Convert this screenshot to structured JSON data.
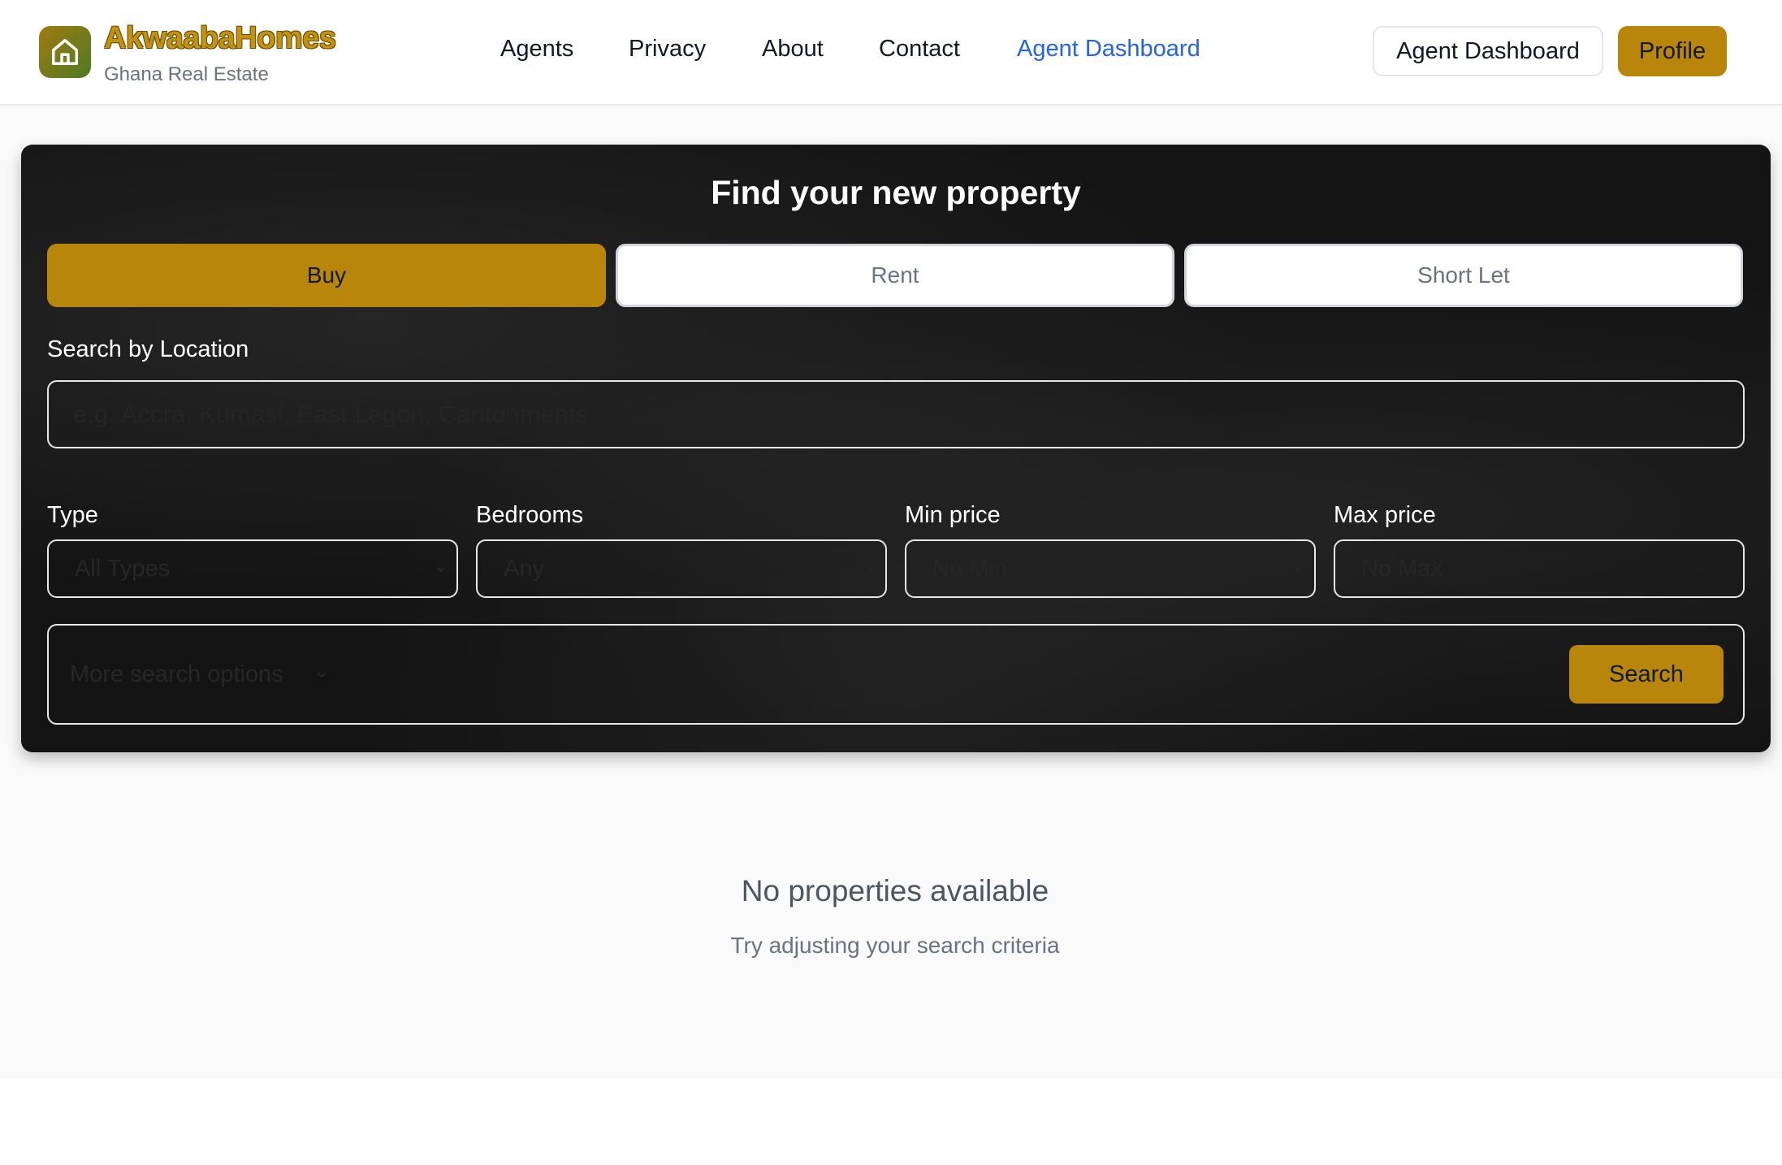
{
  "brand": {
    "name": "AkwaabaHomes",
    "tagline": "Ghana Real Estate"
  },
  "nav": {
    "items": [
      {
        "label": "Agents"
      },
      {
        "label": "Privacy"
      },
      {
        "label": "About"
      },
      {
        "label": "Contact"
      },
      {
        "label": "Agent Dashboard",
        "active": true
      }
    ]
  },
  "header_actions": {
    "agent_dashboard_label": "Agent Dashboard",
    "profile_label": "Profile"
  },
  "search": {
    "title": "Find your new property",
    "tabs": [
      {
        "label": "Buy",
        "selected": true
      },
      {
        "label": "Rent",
        "selected": false
      },
      {
        "label": "Short Let",
        "selected": false
      }
    ],
    "location_label": "Search by Location",
    "location_placeholder": "e.g. Accra, Kumasi, East Legon, Cantonments",
    "filters": [
      {
        "label": "Type",
        "value": "All Types"
      },
      {
        "label": "Bedrooms",
        "value": "Any"
      },
      {
        "label": "Min price",
        "value": "No Min"
      },
      {
        "label": "Max price",
        "value": "No Max"
      }
    ],
    "more_options_label": "More search options",
    "search_button_label": "Search"
  },
  "results": {
    "empty_title": "No properties available",
    "empty_subtitle": "Try adjusting your search criteria"
  },
  "colors": {
    "accent": "#b8860b",
    "active_link": "#2563eb"
  }
}
